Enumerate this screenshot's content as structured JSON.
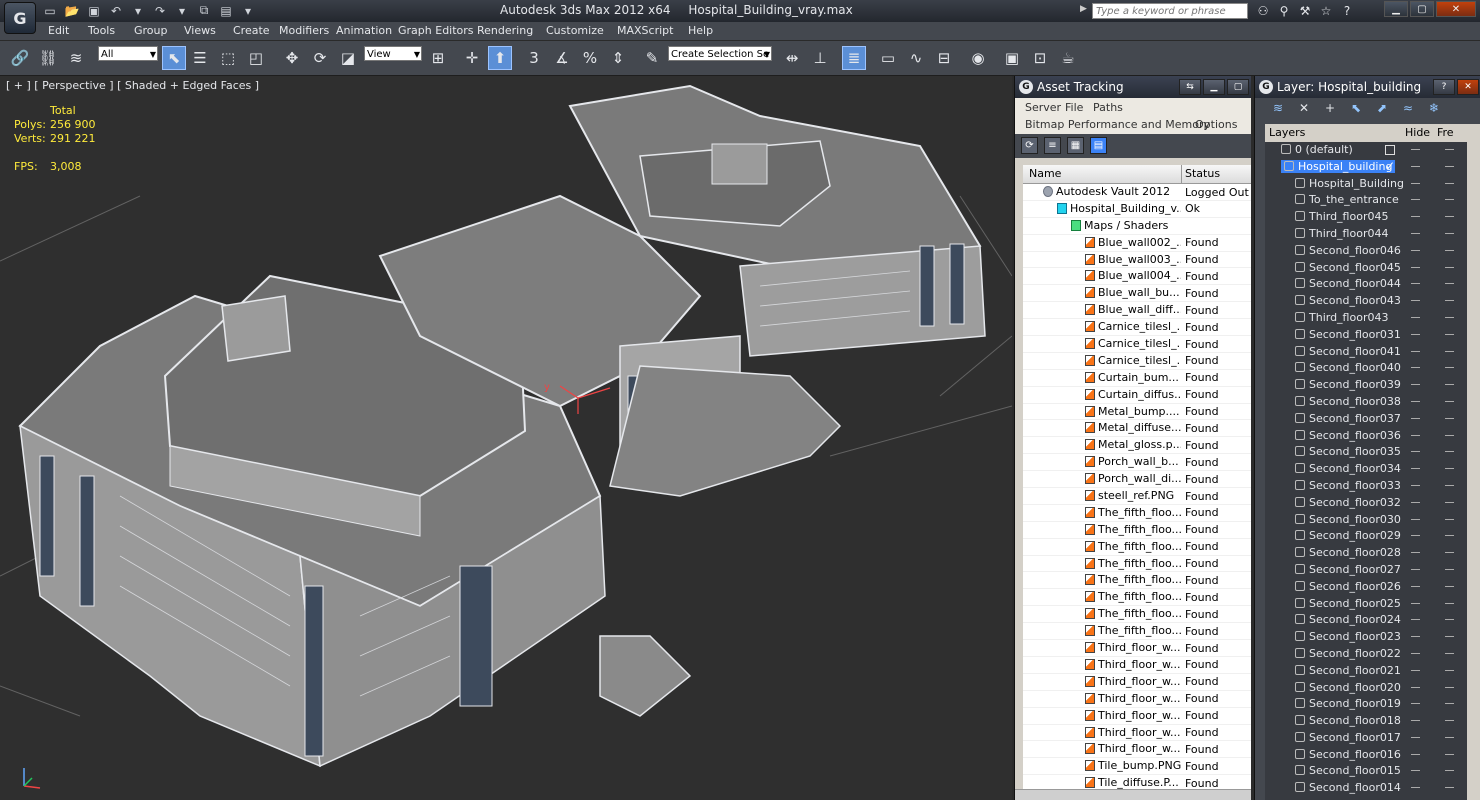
{
  "window": {
    "title_app": "Autodesk 3ds Max  2012 x64",
    "title_file": "Hospital_Building_vray.max",
    "search_placeholder": "Type a keyword or phrase"
  },
  "menu": [
    "Edit",
    "Tools",
    "Group",
    "Views",
    "Create",
    "Modifiers",
    "Animation",
    "Graph Editors",
    "Rendering",
    "Customize",
    "MAXScript",
    "Help"
  ],
  "toolbar": {
    "filter_value": "All",
    "coord_value": "View",
    "named_selection_value": "Create Selection Se"
  },
  "viewport": {
    "label": "[ + ] [ Perspective ] [ Shaded + Edged Faces ]",
    "stats_header": "Total",
    "polys_label": "Polys:",
    "polys_value": "256 900",
    "verts_label": "Verts:",
    "verts_value": "291 221",
    "fps_label": "FPS:",
    "fps_value": "3,008",
    "gizmo_label": "y"
  },
  "asset_tracking": {
    "title": "Asset Tracking",
    "menu": [
      "Server",
      "File",
      "Paths",
      "Bitmap Performance and Memory",
      "Options"
    ],
    "col_name": "Name",
    "col_status": "Status",
    "rows": [
      {
        "name": "Autodesk Vault 2012",
        "status": "Logged Out",
        "icon": "vault",
        "indent": 0
      },
      {
        "name": "Hospital_Building_v...",
        "status": "Ok",
        "icon": "max",
        "indent": 1
      },
      {
        "name": "Maps / Shaders",
        "status": "",
        "icon": "maps",
        "indent": 2
      },
      {
        "name": "Blue_wall002_...",
        "status": "Found",
        "icon": "bmp",
        "indent": 3
      },
      {
        "name": "Blue_wall003_...",
        "status": "Found",
        "icon": "bmp",
        "indent": 3
      },
      {
        "name": "Blue_wall004_...",
        "status": "Found",
        "icon": "bmp",
        "indent": 3
      },
      {
        "name": "Blue_wall_bu...",
        "status": "Found",
        "icon": "bmp",
        "indent": 3
      },
      {
        "name": "Blue_wall_diff...",
        "status": "Found",
        "icon": "bmp",
        "indent": 3
      },
      {
        "name": "Carnice_tilesl_...",
        "status": "Found",
        "icon": "bmp",
        "indent": 3
      },
      {
        "name": "Carnice_tilesl_...",
        "status": "Found",
        "icon": "bmp",
        "indent": 3
      },
      {
        "name": "Carnice_tilesl_...",
        "status": "Found",
        "icon": "bmp",
        "indent": 3
      },
      {
        "name": "Curtain_bum...",
        "status": "Found",
        "icon": "bmp",
        "indent": 3
      },
      {
        "name": "Curtain_diffus...",
        "status": "Found",
        "icon": "bmp",
        "indent": 3
      },
      {
        "name": "Metal_bump....",
        "status": "Found",
        "icon": "bmp",
        "indent": 3
      },
      {
        "name": "Metal_diffuse....",
        "status": "Found",
        "icon": "bmp",
        "indent": 3
      },
      {
        "name": "Metal_gloss.p...",
        "status": "Found",
        "icon": "bmp",
        "indent": 3
      },
      {
        "name": "Porch_wall_b...",
        "status": "Found",
        "icon": "bmp",
        "indent": 3
      },
      {
        "name": "Porch_wall_di...",
        "status": "Found",
        "icon": "bmp",
        "indent": 3
      },
      {
        "name": "steell_ref.PNG",
        "status": "Found",
        "icon": "bmp",
        "indent": 3
      },
      {
        "name": "The_fifth_floo...",
        "status": "Found",
        "icon": "bmp",
        "indent": 3
      },
      {
        "name": "The_fifth_floo...",
        "status": "Found",
        "icon": "bmp",
        "indent": 3
      },
      {
        "name": "The_fifth_floo...",
        "status": "Found",
        "icon": "bmp",
        "indent": 3
      },
      {
        "name": "The_fifth_floo...",
        "status": "Found",
        "icon": "bmp",
        "indent": 3
      },
      {
        "name": "The_fifth_floo...",
        "status": "Found",
        "icon": "bmp",
        "indent": 3
      },
      {
        "name": "The_fifth_floo...",
        "status": "Found",
        "icon": "bmp",
        "indent": 3
      },
      {
        "name": "The_fifth_floo...",
        "status": "Found",
        "icon": "bmp",
        "indent": 3
      },
      {
        "name": "The_fifth_floo...",
        "status": "Found",
        "icon": "bmp",
        "indent": 3
      },
      {
        "name": "Third_floor_w...",
        "status": "Found",
        "icon": "bmp",
        "indent": 3
      },
      {
        "name": "Third_floor_w...",
        "status": "Found",
        "icon": "bmp",
        "indent": 3
      },
      {
        "name": "Third_floor_w...",
        "status": "Found",
        "icon": "bmp",
        "indent": 3
      },
      {
        "name": "Third_floor_w...",
        "status": "Found",
        "icon": "bmp",
        "indent": 3
      },
      {
        "name": "Third_floor_w...",
        "status": "Found",
        "icon": "bmp",
        "indent": 3
      },
      {
        "name": "Third_floor_w...",
        "status": "Found",
        "icon": "bmp",
        "indent": 3
      },
      {
        "name": "Third_floor_w...",
        "status": "Found",
        "icon": "bmp",
        "indent": 3
      },
      {
        "name": "Tile_bump.PNG",
        "status": "Found",
        "icon": "bmp",
        "indent": 3
      },
      {
        "name": "Tile_diffuse.P...",
        "status": "Found",
        "icon": "bmp",
        "indent": 3
      }
    ]
  },
  "layer_panel": {
    "title": "Layer: Hospital_building",
    "col_layers": "Layers",
    "col_hide": "Hide",
    "col_freeze": "Fre",
    "rows": [
      {
        "name": "0 (default)",
        "indent": 0,
        "selected": false
      },
      {
        "name": "Hospital_building",
        "indent": 0,
        "selected": true
      },
      {
        "name": "Hospital_Building",
        "indent": 1,
        "selected": false
      },
      {
        "name": "To_the_entrance",
        "indent": 1,
        "selected": false
      },
      {
        "name": "Third_floor045",
        "indent": 1,
        "selected": false
      },
      {
        "name": "Third_floor044",
        "indent": 1,
        "selected": false
      },
      {
        "name": "Second_floor046",
        "indent": 1,
        "selected": false
      },
      {
        "name": "Second_floor045",
        "indent": 1,
        "selected": false
      },
      {
        "name": "Second_floor044",
        "indent": 1,
        "selected": false
      },
      {
        "name": "Second_floor043",
        "indent": 1,
        "selected": false
      },
      {
        "name": "Third_floor043",
        "indent": 1,
        "selected": false
      },
      {
        "name": "Second_floor031",
        "indent": 1,
        "selected": false
      },
      {
        "name": "Second_floor041",
        "indent": 1,
        "selected": false
      },
      {
        "name": "Second_floor040",
        "indent": 1,
        "selected": false
      },
      {
        "name": "Second_floor039",
        "indent": 1,
        "selected": false
      },
      {
        "name": "Second_floor038",
        "indent": 1,
        "selected": false
      },
      {
        "name": "Second_floor037",
        "indent": 1,
        "selected": false
      },
      {
        "name": "Second_floor036",
        "indent": 1,
        "selected": false
      },
      {
        "name": "Second_floor035",
        "indent": 1,
        "selected": false
      },
      {
        "name": "Second_floor034",
        "indent": 1,
        "selected": false
      },
      {
        "name": "Second_floor033",
        "indent": 1,
        "selected": false
      },
      {
        "name": "Second_floor032",
        "indent": 1,
        "selected": false
      },
      {
        "name": "Second_floor030",
        "indent": 1,
        "selected": false
      },
      {
        "name": "Second_floor029",
        "indent": 1,
        "selected": false
      },
      {
        "name": "Second_floor028",
        "indent": 1,
        "selected": false
      },
      {
        "name": "Second_floor027",
        "indent": 1,
        "selected": false
      },
      {
        "name": "Second_floor026",
        "indent": 1,
        "selected": false
      },
      {
        "name": "Second_floor025",
        "indent": 1,
        "selected": false
      },
      {
        "name": "Second_floor024",
        "indent": 1,
        "selected": false
      },
      {
        "name": "Second_floor023",
        "indent": 1,
        "selected": false
      },
      {
        "name": "Second_floor022",
        "indent": 1,
        "selected": false
      },
      {
        "name": "Second_floor021",
        "indent": 1,
        "selected": false
      },
      {
        "name": "Second_floor020",
        "indent": 1,
        "selected": false
      },
      {
        "name": "Second_floor019",
        "indent": 1,
        "selected": false
      },
      {
        "name": "Second_floor018",
        "indent": 1,
        "selected": false
      },
      {
        "name": "Second_floor017",
        "indent": 1,
        "selected": false
      },
      {
        "name": "Second_floor016",
        "indent": 1,
        "selected": false
      },
      {
        "name": "Second_floor015",
        "indent": 1,
        "selected": false
      },
      {
        "name": "Second_floor014",
        "indent": 1,
        "selected": false
      }
    ]
  },
  "colors": {
    "stats_yellow": "#ffeb3b",
    "selection_blue": "#3b82f6",
    "panel_gray": "#d4d0c8",
    "viewport_bg": "#2f2f2f"
  }
}
